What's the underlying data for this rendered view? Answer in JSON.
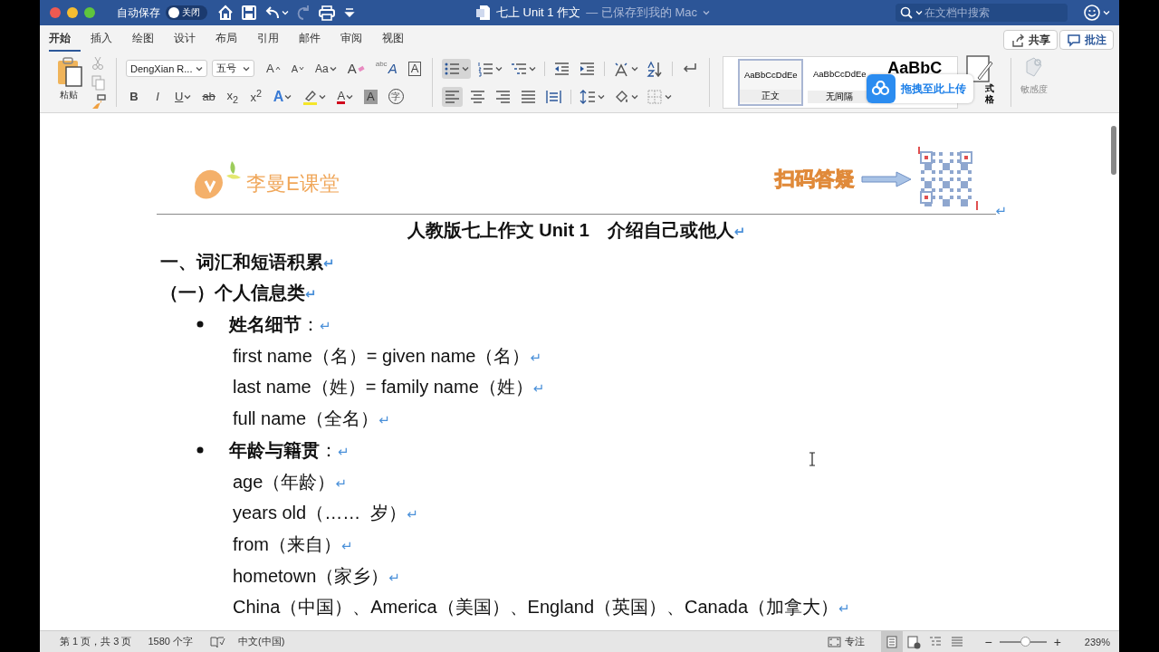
{
  "window": {
    "autosave_label": "自动保存",
    "autosave": {
      "label": "关闭",
      "on": false
    },
    "title": "七上 Unit 1 作文",
    "save_status": "— 已保存到我的 Mac",
    "search_placeholder": "在文档中搜索"
  },
  "ribbon_tabs": [
    {
      "label": "开始",
      "selected": true
    },
    {
      "label": "插入",
      "selected": false
    },
    {
      "label": "绘图",
      "selected": false
    },
    {
      "label": "设计",
      "selected": false
    },
    {
      "label": "布局",
      "selected": false
    },
    {
      "label": "引用",
      "selected": false
    },
    {
      "label": "邮件",
      "selected": false
    },
    {
      "label": "审阅",
      "selected": false
    },
    {
      "label": "视图",
      "selected": false
    }
  ],
  "share_button": "共享",
  "comments_button": "批注",
  "paste_label": "粘贴",
  "font_name": "DengXian R...",
  "font_size": "五号",
  "font_tools_top": [
    {
      "kind": "grow",
      "label": "A"
    },
    {
      "kind": "shrink",
      "label": "A"
    },
    {
      "kind": "case",
      "label": "Aa"
    },
    {
      "kind": "clear",
      "label": "A"
    },
    {
      "kind": "phonetic",
      "label": "A",
      "small": "abc"
    },
    {
      "kind": "border",
      "label": "A"
    }
  ],
  "font_tools_bottom": [
    {
      "kind": "bold",
      "label": "B"
    },
    {
      "kind": "italic",
      "label": "I"
    },
    {
      "kind": "underline",
      "label": "U"
    },
    {
      "kind": "strike",
      "label": "ab"
    },
    {
      "kind": "sub",
      "label": "x$_{2}$"
    },
    {
      "kind": "sup",
      "label": "x$^{2}$"
    },
    {
      "kind": "effects",
      "label": "A"
    },
    {
      "kind": "highlight"
    },
    {
      "kind": "color",
      "label": "A"
    },
    {
      "kind": "shade",
      "label": "A"
    },
    {
      "kind": "enclose",
      "label": "字"
    }
  ],
  "paragraph_tools_top": [
    {
      "kind": "bullets",
      "selected": true
    },
    {
      "kind": "numbering",
      "selected": false
    },
    {
      "kind": "multilevel",
      "selected": false
    },
    {
      "kind": "outdent",
      "selected": false
    },
    {
      "kind": "indent",
      "selected": false
    },
    {
      "kind": "asian",
      "selected": false
    },
    {
      "kind": "sort",
      "selected": false
    },
    {
      "kind": "marks",
      "selected": false
    }
  ],
  "paragraph_tools_bottom": [
    {
      "kind": "left",
      "selected": true
    },
    {
      "kind": "center",
      "selected": false
    },
    {
      "kind": "right",
      "selected": false
    },
    {
      "kind": "justify",
      "selected": false
    },
    {
      "kind": "distributed",
      "selected": false
    },
    {
      "kind": "spacing",
      "selected": false
    },
    {
      "kind": "fill",
      "selected": false
    },
    {
      "kind": "borders",
      "selected": false
    }
  ],
  "styles": [
    {
      "preview": "AaBbCcDdEe",
      "name": "正文",
      "selected": true
    },
    {
      "preview": "AaBbCcDdEe",
      "name": "无间隔",
      "selected": false
    },
    {
      "preview": "AaBbC",
      "selected": false
    }
  ],
  "styles_pane_lines": [
    "式",
    "格"
  ],
  "upload_popup": "拖拽至此上传",
  "sensitivity_label": "敏感度",
  "document": {
    "logo_text": "李曼E课堂",
    "header_note": "扫码答疑",
    "header_mark": "↵",
    "title": "人教版七上作文 Unit 1　介绍自己或他人",
    "title_mark": "↵",
    "heading": "一、词汇和短语积累",
    "heading_mark": "↵",
    "subheading": "（一）个人信息类",
    "subheading_mark": "↵",
    "bullets": [
      {
        "label": "姓名细节",
        "suffix": "：",
        "mark": "↵",
        "lines": [
          {
            "text": "first name（名）= given name（名）",
            "mark": "↵"
          },
          {
            "text": "last name（姓）= family name（姓）",
            "mark": "↵"
          },
          {
            "text": "full name（全名）",
            "mark": "↵"
          }
        ]
      },
      {
        "label": "年龄与籍贯",
        "suffix": "：",
        "mark": "↵",
        "lines": [
          {
            "text": "age（年龄）",
            "mark": "↵"
          },
          {
            "text": "years old（……  岁）",
            "mark": "↵"
          },
          {
            "text": "from（来自）",
            "mark": "↵"
          },
          {
            "text": "hometown（家乡）",
            "mark": "↵"
          },
          {
            "text": "China（中国）、America（美国）、England（英国）、Canada（加拿大）",
            "mark": "↵"
          }
        ]
      }
    ]
  },
  "status_bar": {
    "page": "第 1 页，共 3 页",
    "words": "1580 个字",
    "language": "中文(中国)",
    "focus": "专注",
    "views": [
      {
        "kind": "print",
        "selected": true
      },
      {
        "kind": "web",
        "selected": false
      },
      {
        "kind": "outline",
        "selected": false
      },
      {
        "kind": "draft",
        "selected": false
      }
    ],
    "zoom_out": "−",
    "zoom_slider": {
      "level": 0.55
    },
    "zoom_in": "+",
    "zoom": "239%"
  }
}
